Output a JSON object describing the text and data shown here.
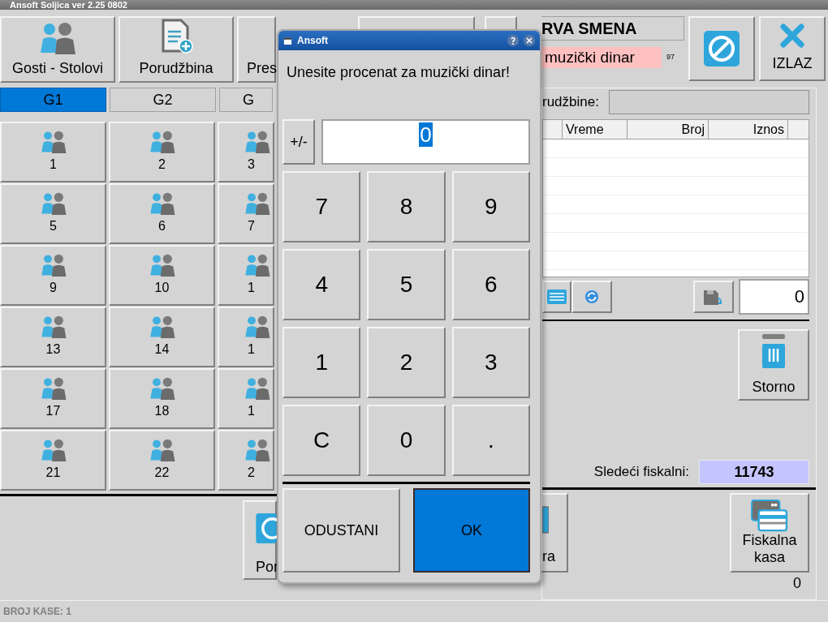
{
  "window": {
    "title": "Ansoft Soljica ver 2.25 0802"
  },
  "toolbar": [
    {
      "label": "Gosti - Stolovi",
      "kind": "guests"
    },
    {
      "label": "Porudžbina",
      "kind": "order"
    },
    {
      "label": "Pres",
      "kind": "partial"
    }
  ],
  "shift": {
    "name": "RVA SMENA",
    "music_tax": "muzički dinar",
    "count": "97"
  },
  "actions": [
    {
      "kind": "cancel"
    },
    {
      "kind": "exit",
      "label": "IZLAZ"
    }
  ],
  "groups": [
    {
      "label": "G1",
      "selected": true
    },
    {
      "label": "G2",
      "selected": false
    },
    {
      "label": "G",
      "selected": false
    }
  ],
  "tables": [
    [
      "1",
      "2",
      "3"
    ],
    [
      "5",
      "6",
      "7"
    ],
    [
      "9",
      "10",
      "1"
    ],
    [
      "13",
      "14",
      "1"
    ],
    [
      "17",
      "18",
      "1"
    ],
    [
      "21",
      "22",
      "2"
    ]
  ],
  "orders": {
    "label": "rudžbine:",
    "columns": [
      "Vreme",
      "Broj",
      "Iznos"
    ],
    "total": "0"
  },
  "storno": "Storno",
  "next_fiscal": {
    "label": "Sledeći fiskalni:",
    "value": "11743"
  },
  "bottom_buttons": [
    {
      "label": "Por"
    },
    {
      "label": "ra"
    },
    {
      "label": "Fiskalna kasa"
    }
  ],
  "count": "0",
  "status": "BROJ KASE: 1",
  "dialog": {
    "title": "Ansoft",
    "prompt": "Unesite procenat za muzički dinar!",
    "sign": "+/-",
    "value": "0",
    "keys": [
      "7",
      "8",
      "9",
      "4",
      "5",
      "6",
      "1",
      "2",
      "3",
      "C",
      "0",
      "."
    ],
    "cancel": "ODUSTANI",
    "ok": "OK"
  }
}
